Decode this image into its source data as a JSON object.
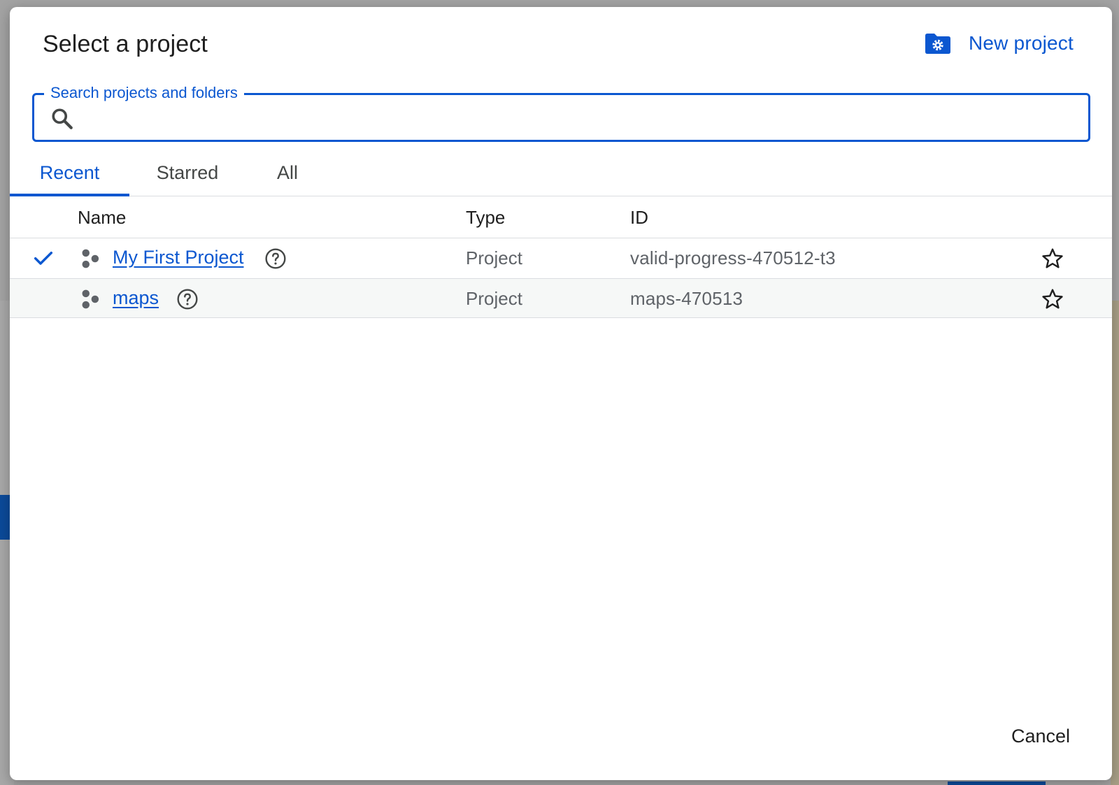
{
  "dialog": {
    "title": "Select a project",
    "new_project_label": "New project"
  },
  "search": {
    "label": "Search projects and folders",
    "value": "",
    "placeholder": ""
  },
  "tabs": [
    {
      "label": "Recent",
      "active": true
    },
    {
      "label": "Starred",
      "active": false
    },
    {
      "label": "All",
      "active": false
    }
  ],
  "table": {
    "columns": {
      "name": "Name",
      "type": "Type",
      "id": "ID"
    },
    "rows": [
      {
        "name": "My First Project",
        "type": "Project",
        "id": "valid-progress-470512-t3",
        "selected": true,
        "starred": false
      },
      {
        "name": "maps",
        "type": "Project",
        "id": "maps-470513",
        "selected": false,
        "starred": false
      }
    ]
  },
  "footer": {
    "cancel_label": "Cancel"
  },
  "colors": {
    "accent": "#0b57d0",
    "text_primary": "#1f1f1f",
    "text_secondary": "#5f6368",
    "divider": "#dadce0"
  },
  "icons": [
    "folder-settings-icon",
    "search-icon",
    "check-icon",
    "project-icon",
    "help-icon",
    "star-outline-icon"
  ]
}
